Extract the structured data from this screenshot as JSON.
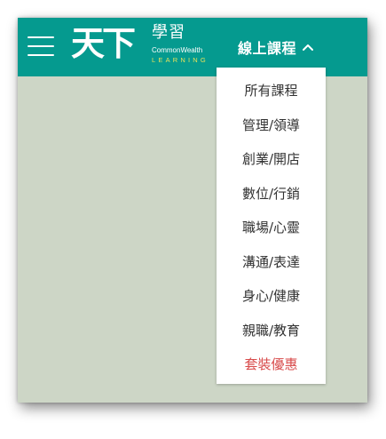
{
  "header": {
    "logo": {
      "main": "天下",
      "sub": "學習",
      "en_line1": "CommonWealth",
      "en_line2": "LEARNING"
    },
    "nav": {
      "label": "線上課程",
      "icon": "chevron-up-icon"
    }
  },
  "dropdown": {
    "items": [
      {
        "label": "所有課程"
      },
      {
        "label": "管理/領導"
      },
      {
        "label": "創業/開店"
      },
      {
        "label": "數位/行銷"
      },
      {
        "label": "職場/心靈"
      },
      {
        "label": "溝通/表達"
      },
      {
        "label": "身心/健康"
      },
      {
        "label": "親職/教育"
      },
      {
        "label": "套裝優惠"
      }
    ]
  },
  "colors": {
    "header_bg": "#059a8f",
    "page_bg": "#cdd6c6",
    "promo_text": "#d84b4b",
    "logo_accent": "#e7e25a"
  }
}
